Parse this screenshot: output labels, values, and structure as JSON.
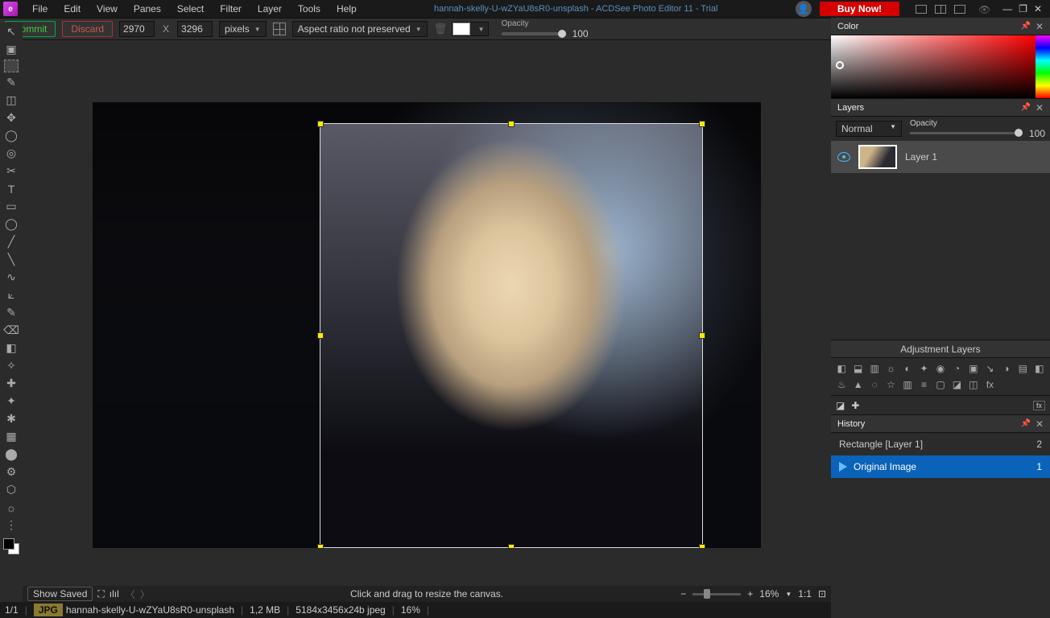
{
  "menu": {
    "items": [
      "File",
      "Edit",
      "View",
      "Panes",
      "Select",
      "Filter",
      "Layer",
      "Tools",
      "Help"
    ]
  },
  "title": "hannah-skelly-U-wZYaU8sR0-unsplash - ACDSee Photo Editor 11 - Trial",
  "buy": "Buy Now!",
  "optionsbar": {
    "commit": "Commit",
    "discard": "Discard",
    "width": "2970",
    "height": "3296",
    "x": "X",
    "units": "pixels",
    "aspect": "Aspect ratio not preserved",
    "opacity_label": "Opacity",
    "opacity_val": "100"
  },
  "tools": [
    "↖",
    "▣",
    "⬚",
    "✎",
    "◫",
    "✥",
    "◯",
    "◎",
    "✂",
    "T",
    "▭",
    "◯",
    "╱",
    "╲",
    "∿",
    "⟀",
    "✎",
    "⌫",
    "◧",
    "✧",
    "✚",
    "✦",
    "✱",
    "▦",
    "⬤",
    "⚙",
    "⬡",
    "☼",
    "⋮"
  ],
  "nav": {
    "show_saved": "Show Saved",
    "hint": "Click and drag to resize the canvas.",
    "zoom": "16%",
    "one": "1:1"
  },
  "status": {
    "page": "1/1",
    "badge": "JPG",
    "file": "hannah-skelly-U-wZYaU8sR0-unsplash",
    "dims": "5184x3456x24b jpeg",
    "size": "1,2 MB",
    "zoom": "16%"
  },
  "panels": {
    "color": "Color",
    "layers": {
      "title": "Layers",
      "blend": "Normal",
      "op_label": "Opacity",
      "op_val": "100",
      "layer_name": "Layer 1"
    },
    "adj": {
      "title": "Adjustment Layers",
      "icons": [
        "◧",
        "⬓",
        "▥",
        "☼",
        "◐",
        "✦",
        "◉",
        "◔",
        "▣",
        "↘",
        "◑",
        "▤",
        "◧",
        "♨",
        "▲",
        "◌",
        "☆",
        "▥",
        "≡",
        "▢",
        "◪",
        "◫",
        "fx"
      ]
    },
    "history": {
      "title": "History",
      "items": [
        {
          "label": "Rectangle [Layer 1]",
          "n": "2",
          "active": false
        },
        {
          "label": "Original Image",
          "n": "1",
          "active": true
        }
      ]
    }
  }
}
